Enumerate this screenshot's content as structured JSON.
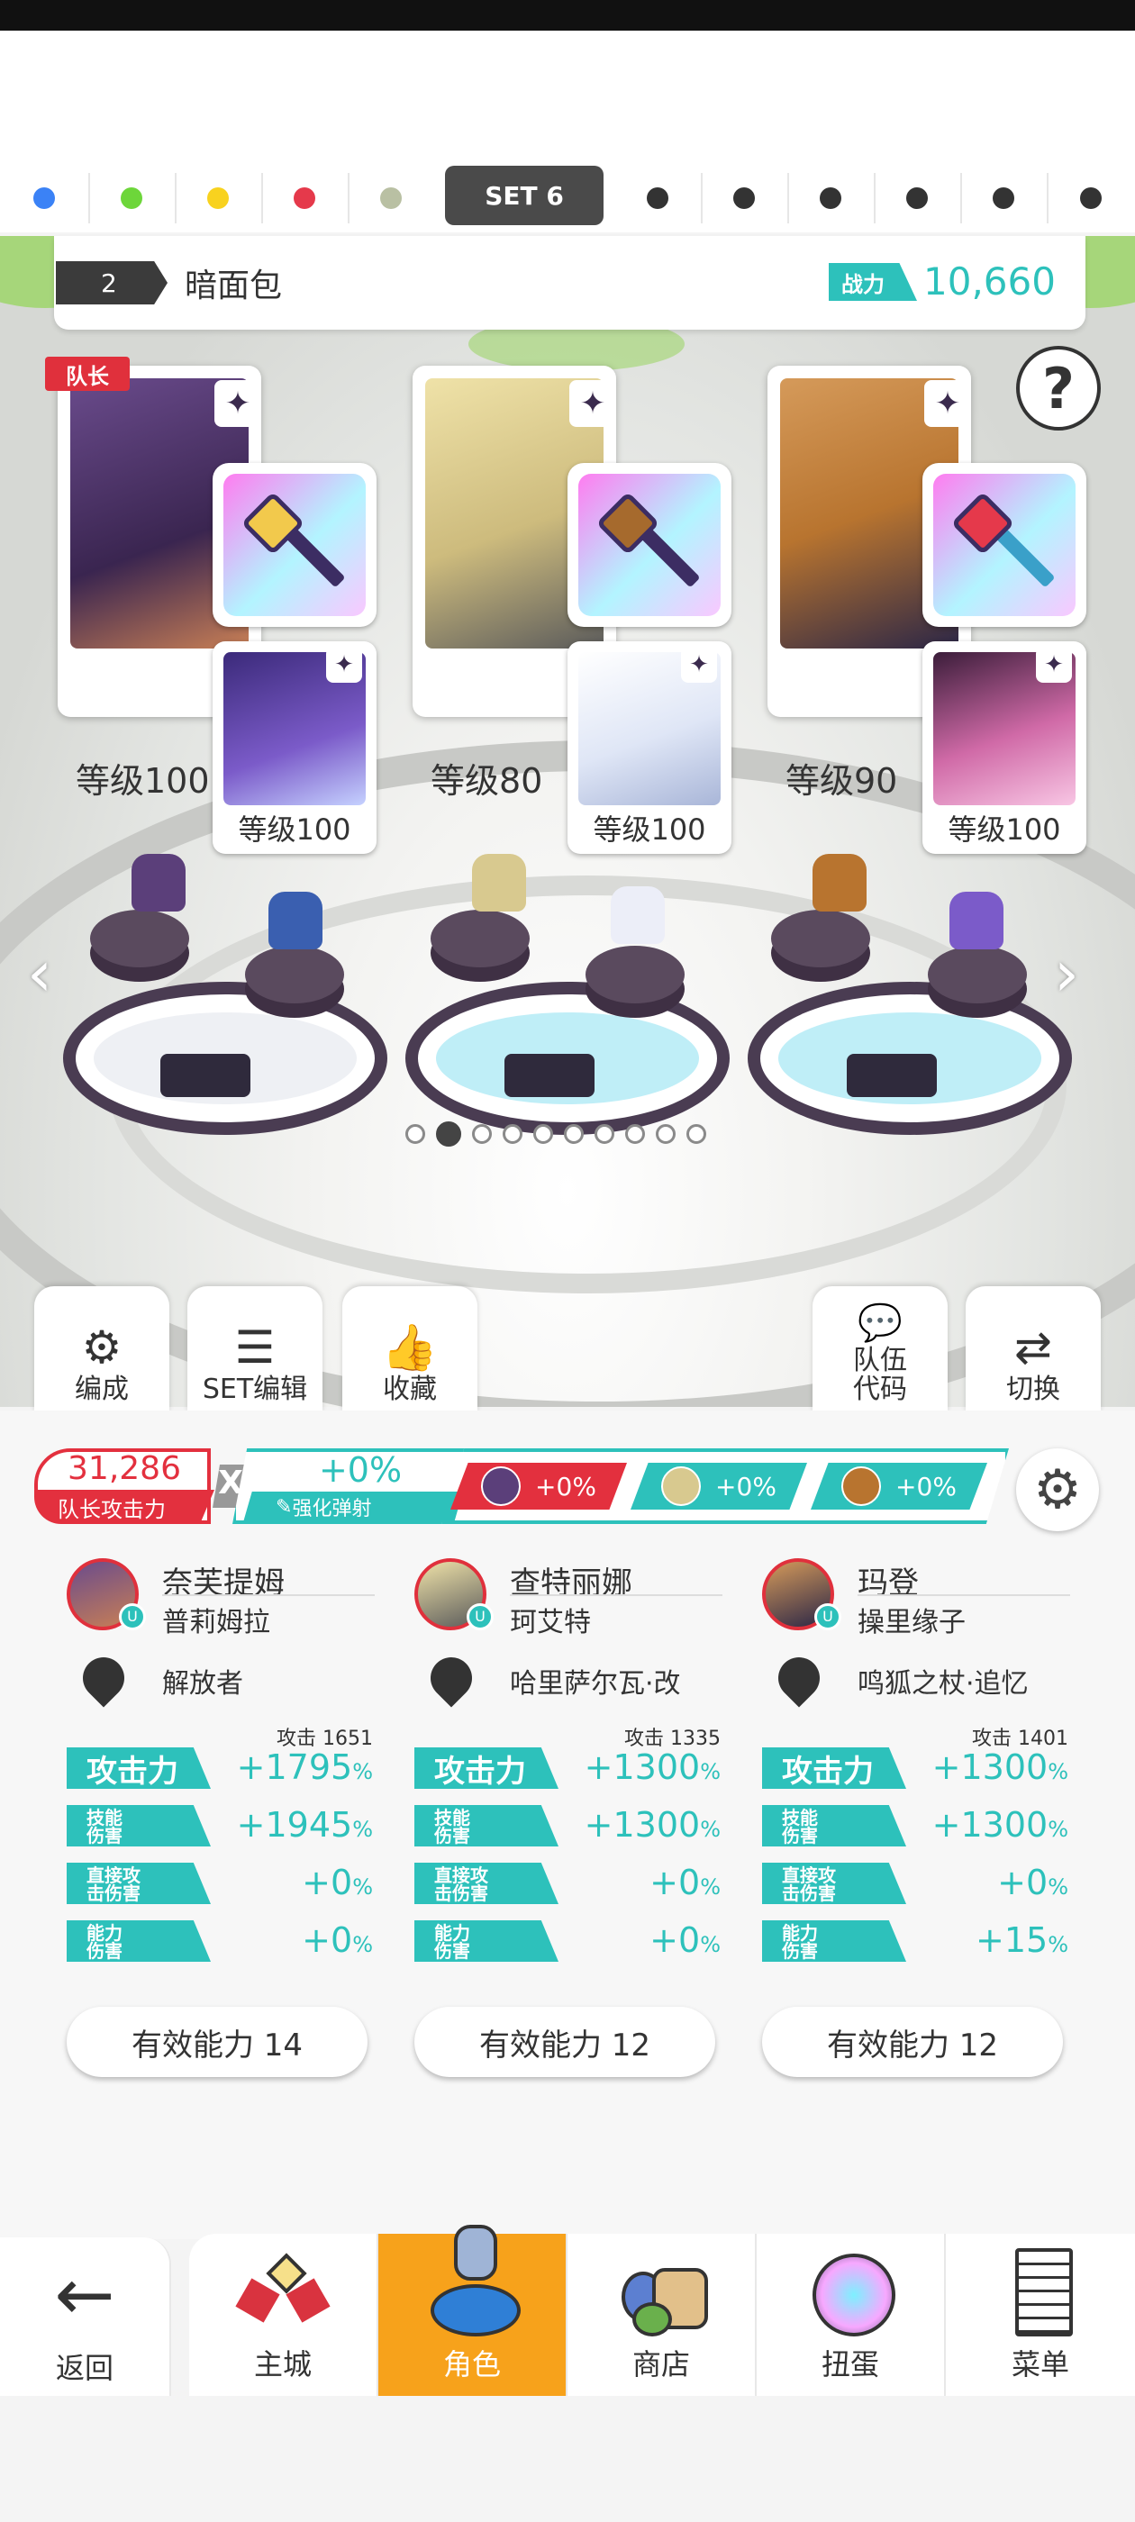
{
  "set_bar": {
    "dots_left": [
      "#3b82f6",
      "#6dd63a",
      "#f8d21f",
      "#e5394b",
      "#b9c0a3"
    ],
    "active_label": "SET 6",
    "dots_right_color": "#333333",
    "dots_right_count": 6
  },
  "team": {
    "number": "2",
    "name": "暗面包",
    "power_label": "战力",
    "power_value": "10,660"
  },
  "characters": [
    {
      "leader_label": "队长",
      "main_level": "等级100",
      "sub_level": "等级100",
      "art_color": "#5b3f7a",
      "sub_color": "#7b5bc9"
    },
    {
      "main_level": "等级80",
      "sub_level": "等级100",
      "art_color": "#d8c98f",
      "sub_color": "#dfe6f6"
    },
    {
      "main_level": "等级90",
      "sub_level": "等级100",
      "art_color": "#b8742f",
      "sub_color": "#d06aa7"
    }
  ],
  "pager": {
    "count": 10,
    "active": 1
  },
  "toolbar": {
    "formation": "编成",
    "set_edit": "SET编辑",
    "favorite": "收藏",
    "team_code": "队伍\n代码",
    "switch": "切换"
  },
  "summary": {
    "leader_attack_value": "31,286",
    "leader_attack_label": "队长攻击力",
    "x": "X",
    "boost_value": "+0%",
    "boost_label": "强化弹射",
    "chips": [
      "+0%",
      "+0%",
      "+0%"
    ]
  },
  "heroes": [
    {
      "name": "奈芙提姆",
      "sub": "普莉姆拉",
      "weapon": "解放者",
      "attack_note": "攻击 1651",
      "attack_label": "攻击力",
      "attack": "+1795",
      "skill_label": "技能\n伤害",
      "skill": "+1945",
      "direct_label": "直接攻\n击伤害",
      "direct": "+0",
      "ability_label": "能力\n伤害",
      "ability": "+0",
      "effective": "有效能力 14"
    },
    {
      "name": "查特丽娜",
      "sub": "珂艾特",
      "weapon": "哈里萨尔瓦·改",
      "attack_note": "攻击 1335",
      "attack_label": "攻击力",
      "attack": "+1300",
      "skill_label": "技能\n伤害",
      "skill": "+1300",
      "direct_label": "直接攻\n击伤害",
      "direct": "+0",
      "ability_label": "能力\n伤害",
      "ability": "+0",
      "effective": "有效能力 12"
    },
    {
      "name": "玛登",
      "sub": "操里缘子",
      "weapon": "鸣狐之杖·追忆",
      "attack_note": "攻击 1401",
      "attack_label": "攻击力",
      "attack": "+1300",
      "skill_label": "技能\n伤害",
      "skill": "+1300",
      "direct_label": "直接攻\n击伤害",
      "direct": "+0",
      "ability_label": "能力\n伤害",
      "ability": "+15",
      "effective": "有效能力 12"
    }
  ],
  "percent_sign": "%",
  "nav": {
    "back": "返回",
    "castle": "主城",
    "character": "角色",
    "shop": "商店",
    "gacha": "扭蛋",
    "menu": "菜单"
  },
  "colors": {
    "teal": "#2dc1bb",
    "red": "#e3303e",
    "active_nav": "#f7a21b"
  }
}
